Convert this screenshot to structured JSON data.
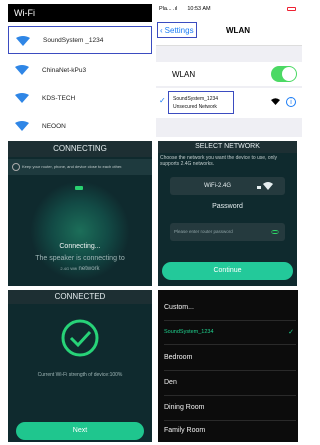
{
  "android_wifi": {
    "title": "Wi-Fi",
    "networks": [
      {
        "name": "SoundSystem _1234",
        "selected": true
      },
      {
        "name": "ChinaNet-kPu3",
        "selected": false
      },
      {
        "name": "KDS-TECH",
        "selected": false
      },
      {
        "name": "NEOON",
        "selected": false
      }
    ],
    "accent": "#2f86e6"
  },
  "ios_wlan": {
    "status_carrier": "Pla... .ıl",
    "status_time": "10:53 AM",
    "back_label": "Settings",
    "title": "WLAN",
    "wlan_label": "WLAN",
    "wlan_on": true,
    "network_name": "SoundSystem_1234",
    "network_sub": "Unsecured Network",
    "info_glyph": "i"
  },
  "connecting": {
    "header": "CONNECTING",
    "tip": "Keep your router, phone, and device close to each other.",
    "line1": "Connecting...",
    "line2": "The speaker is connecting to",
    "line3_prefix": "2.4G Wifi",
    "line3_suffix": "network"
  },
  "select_network": {
    "header": "SELECT NETWORK",
    "description": "Choose the network you want the device to use, only supports 2.4G networks.",
    "network": "WiFi-2.4G",
    "password_label": "Password",
    "password_placeholder": "Please enter router password",
    "continue_label": "Continue"
  },
  "connected": {
    "header": "CONNECTED",
    "strength": "Current Wi-Fi strength of device:100%",
    "next_label": "Next"
  },
  "rooms": {
    "items": [
      "Custom...",
      "SoundSystem_1234",
      "Bedroom",
      "Den",
      "Dining Room",
      "Family Room"
    ],
    "active_index": 1
  }
}
